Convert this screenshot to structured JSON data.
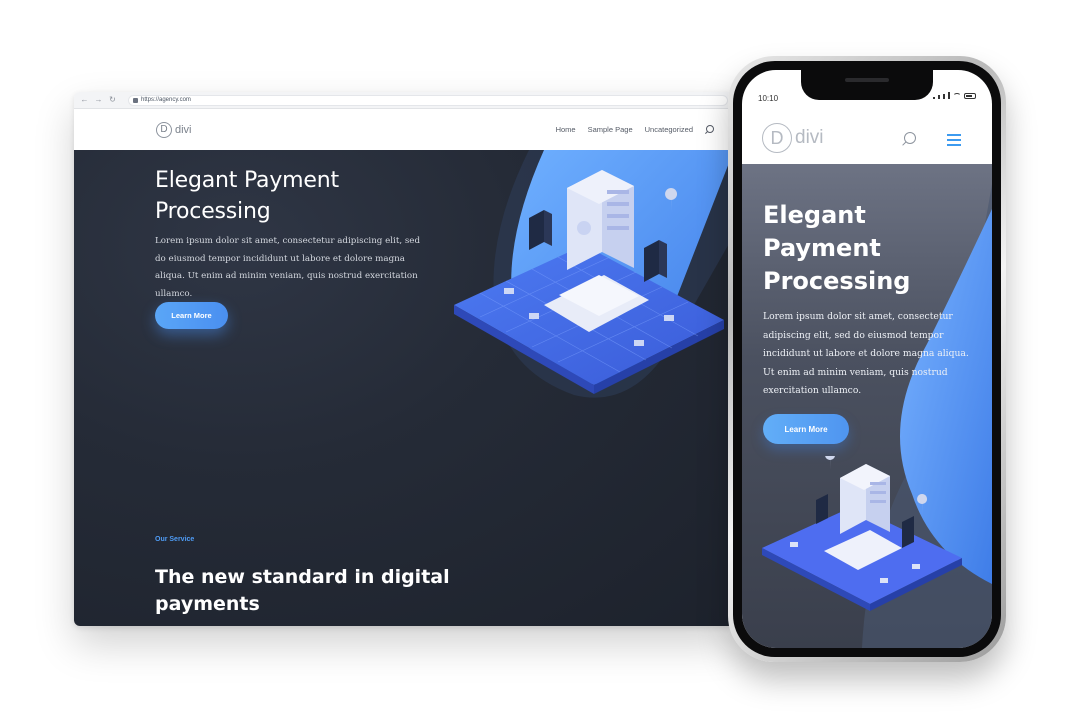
{
  "desktop": {
    "browser": {
      "url": "https://agency.com",
      "nav_buttons": [
        "←",
        "→",
        "↻"
      ]
    },
    "header": {
      "logo_letter": "D",
      "logo_text": "divi",
      "nav": [
        "Home",
        "Sample Page",
        "Uncategorized"
      ]
    },
    "hero": {
      "title": "Elegant Payment Processing",
      "body": "Lorem ipsum dolor sit amet, consectetur adipiscing elit, sed do eiusmod tempor incididunt ut labore et dolore magna aliqua. Ut enim ad minim veniam, quis nostrud exercitation ullamco.",
      "button": "Learn More"
    },
    "service": {
      "label": "Our Service",
      "title": "The new standard in digital payments"
    }
  },
  "mobile": {
    "status_time": "10:10",
    "header": {
      "logo_letter": "D",
      "logo_text": "divi"
    },
    "hero": {
      "title": "Elegant Payment Processing",
      "body": "Lorem ipsum dolor sit amet, consectetur adipiscing elit, sed do eiusmod tempor incididunt ut labore et dolore magna aliqua. Ut enim ad minim veniam, quis nostrud exercitation ullamco.",
      "button": "Learn More"
    }
  },
  "colors": {
    "accent": "#4f9cf5",
    "hero_dark": "#252b37",
    "blob_blue": "#4a8ff0"
  }
}
